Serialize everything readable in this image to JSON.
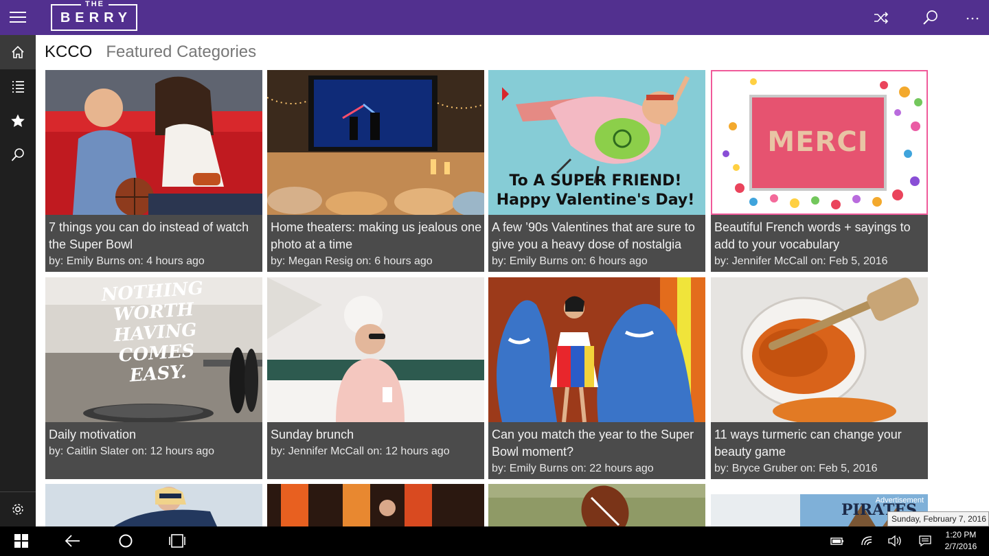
{
  "app": {
    "logo_top": "THE",
    "logo_name": "BERRY"
  },
  "topbar": {
    "icons": [
      "menu-icon",
      "shuffle-icon",
      "search-icon",
      "more-icon"
    ]
  },
  "sidebar": {
    "items": [
      "home-icon",
      "list-icon",
      "star-icon",
      "search-icon",
      "gear-icon"
    ]
  },
  "header": {
    "title": "KCCO",
    "subtitle": "Featured Categories"
  },
  "cards": [
    {
      "title": "7 things you can do instead of watch the Super Bowl",
      "meta": "by: Emily Burns on: 4 hours ago"
    },
    {
      "title": "Home theaters: making us jealous one photo at a time",
      "meta": "by: Megan Resig on: 6 hours ago"
    },
    {
      "title": "A few ’90s Valentines that are sure to give you a heavy dose of nostalgia",
      "meta": "by: Emily Burns on: 6 hours ago"
    },
    {
      "title": "Beautiful French words + sayings to add to your vocabulary",
      "meta": "by: Jennifer McCall on: Feb 5, 2016"
    },
    {
      "title": "Daily motivation",
      "meta": "by: Caitlin Slater on: 12 hours ago"
    },
    {
      "title": "Sunday brunch",
      "meta": "by: Jennifer McCall on: 12 hours ago"
    },
    {
      "title": "Can you match the year to the Super Bowl moment?",
      "meta": "by: Emily Burns on: 22 hours ago"
    },
    {
      "title": "11 ways turmeric can change your beauty game",
      "meta": "by: Bryce Gruber on: Feb 5, 2016"
    }
  ],
  "image_text": {
    "valentine_line1": "To A SUPER FRIEND!",
    "valentine_line2": "Happy Valentine's Day!",
    "merci": "MERCI",
    "motivation": "NOTHING WORTH HAVING COMES EASY.",
    "ad_label": "Advertisement",
    "ad_brand": "PIRATES"
  },
  "taskbar": {
    "icons": [
      "windows-icon",
      "back-icon",
      "cortana-icon",
      "task-view-icon",
      "battery-icon",
      "wifi-icon",
      "volume-icon",
      "notification-icon"
    ],
    "time": "1:20 PM",
    "date": "2/7/2016",
    "tooltip": "Sunday, February 7, 2016"
  },
  "colors": {
    "brand": "#52308f",
    "sidebar": "#1f1f1f",
    "card": "#4b4b4b"
  }
}
